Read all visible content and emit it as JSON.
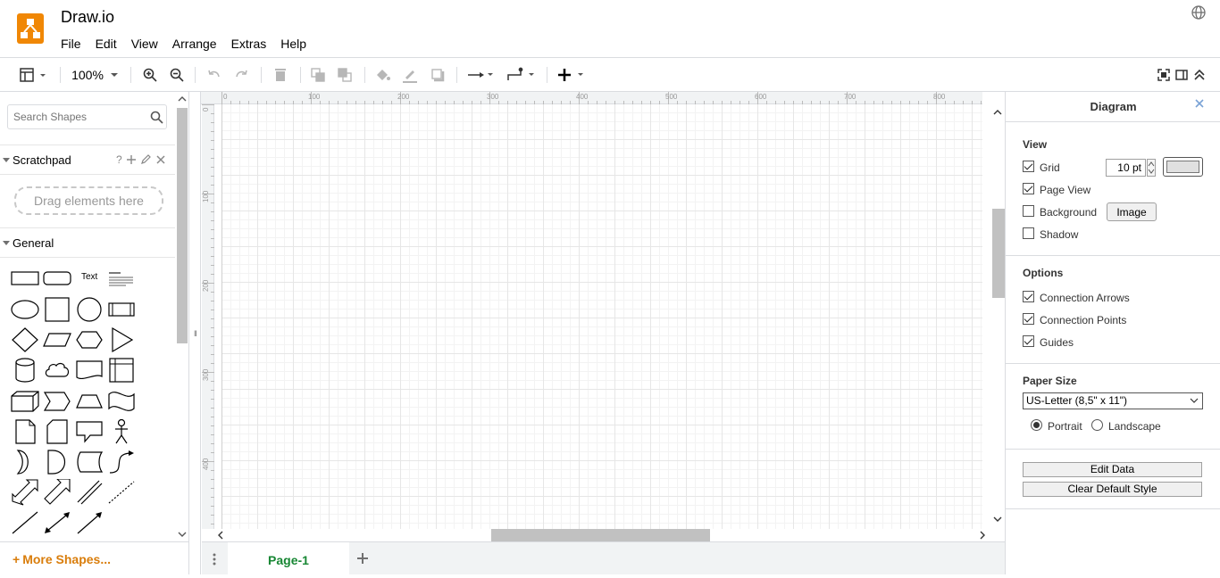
{
  "app": {
    "title": "Draw.io"
  },
  "menu": [
    "File",
    "Edit",
    "View",
    "Arrange",
    "Extras",
    "Help"
  ],
  "toolbar": {
    "zoom": "100%"
  },
  "sidebar": {
    "search_placeholder": "Search Shapes",
    "scratchpad_title": "Scratchpad",
    "scratchpad_help": "?",
    "drag_hint": "Drag elements here",
    "general_title": "General",
    "shape_text_label": "Text",
    "more_shapes": "More Shapes..."
  },
  "rulers": {
    "horizontal": [
      "0",
      "100",
      "200",
      "300",
      "400",
      "500",
      "600",
      "700",
      "800"
    ],
    "vertical": [
      "0",
      "100",
      "200",
      "300",
      "400"
    ]
  },
  "pages": {
    "tabs": [
      "Page-1"
    ]
  },
  "format_panel": {
    "title": "Diagram",
    "view": {
      "heading": "View",
      "grid": "Grid",
      "grid_size": "10 pt",
      "page_view": "Page View",
      "background": "Background",
      "image_button": "Image",
      "shadow": "Shadow"
    },
    "options": {
      "heading": "Options",
      "connection_arrows": "Connection Arrows",
      "connection_points": "Connection Points",
      "guides": "Guides"
    },
    "paper": {
      "heading": "Paper Size",
      "size": "US-Letter (8,5\" x 11\")",
      "portrait": "Portrait",
      "landscape": "Landscape"
    },
    "actions": {
      "edit_data": "Edit Data",
      "clear_default_style": "Clear Default Style"
    }
  },
  "colors": {
    "accent": "#f08705",
    "page_tab_text": "#188734",
    "more_shapes": "#d97d0b"
  }
}
